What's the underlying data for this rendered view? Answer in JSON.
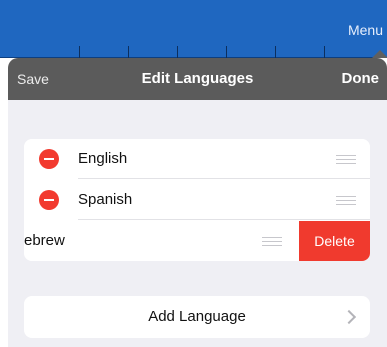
{
  "background_app": {
    "menu_label": "Menu"
  },
  "popover": {
    "nav": {
      "save_label": "Save",
      "title": "Edit Languages",
      "done_label": "Done"
    },
    "languages": [
      {
        "label": "English"
      },
      {
        "label": "Spanish"
      },
      {
        "label": "Hebrew",
        "visible_text": "ebrew",
        "swiped": true
      }
    ],
    "delete_label": "Delete",
    "add_language_label": "Add Language"
  },
  "colors": {
    "app_bar": "#1f67c0",
    "nav_bar": "#5b5b5b",
    "destructive": "#f03a2e",
    "grouped_background": "#efeff4"
  },
  "icons": {
    "remove": "minus-circle-icon",
    "reorder": "reorder-grip-icon",
    "disclosure": "chevron-right-icon"
  }
}
